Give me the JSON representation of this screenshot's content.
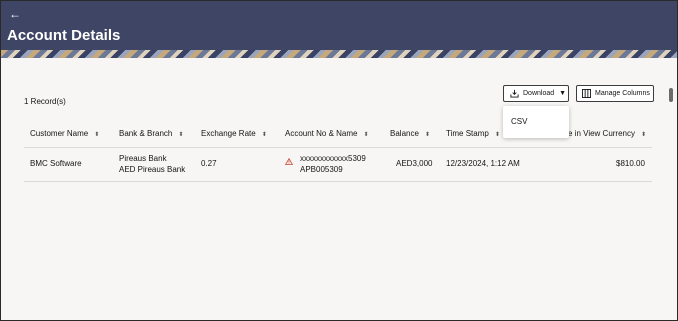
{
  "header": {
    "back_icon": "arrow-left-icon",
    "title": "Account Details",
    "colors": {
      "bar": "#3f4565",
      "text": "#ffffff"
    }
  },
  "toolbar": {
    "records": "1 Record(s)",
    "download_label": "Download",
    "download_icon": "download-icon",
    "manage_columns_label": "Manage Columns",
    "manage_columns_icon": "columns-icon"
  },
  "download_menu": {
    "items": [
      "CSV"
    ]
  },
  "table": {
    "columns": [
      "Customer Name",
      "Bank & Branch",
      "Exchange Rate",
      "Account No & Name",
      "Balance",
      "Time Stamp",
      "e in View Currency"
    ],
    "rows": [
      {
        "customer_name": "BMC Software",
        "bank": "Pireaus Bank",
        "branch": "AED Pireaus Bank",
        "exchange_rate": "0.27",
        "account_no": "xxxxxxxxxxxx5309",
        "account_name": "APB005309",
        "account_status_icon": "warning-icon",
        "balance": "AED3,000",
        "time_stamp": "12/23/2024, 1:12 AM",
        "view_currency_balance": "$810.00"
      }
    ]
  }
}
